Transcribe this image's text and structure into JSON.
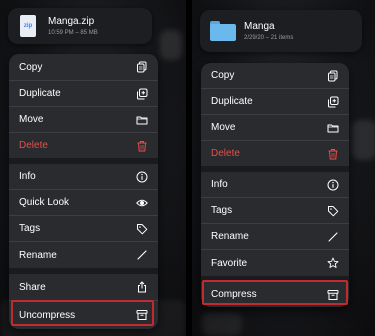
{
  "left_panel": {
    "file": {
      "thumb_label": "zip",
      "name": "Manga.zip",
      "meta": "10:59 PM – 85 MB"
    },
    "menu_items": [
      {
        "label": "Copy",
        "icon": "copy-icon",
        "destructive": false
      },
      {
        "label": "Duplicate",
        "icon": "duplicate-icon",
        "destructive": false
      },
      {
        "label": "Move",
        "icon": "folder-icon",
        "destructive": false
      },
      {
        "label": "Delete",
        "icon": "trash-icon",
        "destructive": true
      },
      {
        "label": "Info",
        "icon": "info-icon",
        "destructive": false
      },
      {
        "label": "Quick Look",
        "icon": "eye-icon",
        "destructive": false
      },
      {
        "label": "Tags",
        "icon": "tag-icon",
        "destructive": false
      },
      {
        "label": "Rename",
        "icon": "pencil-icon",
        "destructive": false
      },
      {
        "label": "Share",
        "icon": "share-icon",
        "destructive": false
      },
      {
        "label": "Uncompress",
        "icon": "archive-icon",
        "destructive": false,
        "highlighted": true
      }
    ]
  },
  "right_panel": {
    "file": {
      "name": "Manga",
      "meta": "2/29/20 – 21 items"
    },
    "menu_items": [
      {
        "label": "Copy",
        "icon": "copy-icon",
        "destructive": false
      },
      {
        "label": "Duplicate",
        "icon": "duplicate-icon",
        "destructive": false
      },
      {
        "label": "Move",
        "icon": "folder-icon",
        "destructive": false
      },
      {
        "label": "Delete",
        "icon": "trash-icon",
        "destructive": true
      },
      {
        "label": "Info",
        "icon": "info-icon",
        "destructive": false
      },
      {
        "label": "Tags",
        "icon": "tag-icon",
        "destructive": false
      },
      {
        "label": "Rename",
        "icon": "pencil-icon",
        "destructive": false
      },
      {
        "label": "Favorite",
        "icon": "star-icon",
        "destructive": false
      },
      {
        "label": "Compress",
        "icon": "archive-icon",
        "destructive": false,
        "highlighted": true
      }
    ]
  },
  "colors": {
    "destructive": "#e5504a",
    "highlight_border": "#c12a2f",
    "menu_background": "#2a2b2f"
  }
}
